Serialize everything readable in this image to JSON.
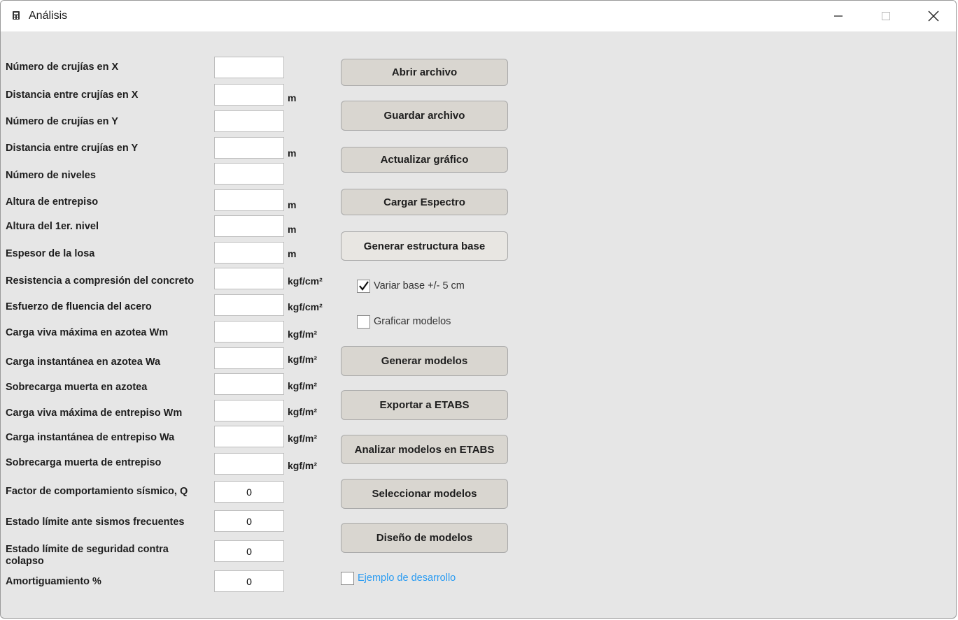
{
  "window": {
    "title": "Análisis",
    "app_icon": "calculator-icon",
    "controls": [
      "minimize-icon",
      "maximize-icon",
      "close-icon"
    ]
  },
  "form": {
    "fields": [
      {
        "label": "Número de crujías en X",
        "value": "",
        "unit": ""
      },
      {
        "label": "Distancia entre crujías en X",
        "value": "",
        "unit": "m"
      },
      {
        "label": "Número de crujías en Y",
        "value": "",
        "unit": ""
      },
      {
        "label": "Distancia entre crujías en Y",
        "value": "",
        "unit": "m"
      },
      {
        "label": "Número de niveles",
        "value": "",
        "unit": ""
      },
      {
        "label": "Altura de entrepiso",
        "value": "",
        "unit": "m"
      },
      {
        "label": "Altura del 1er. nivel",
        "value": "",
        "unit": "m"
      },
      {
        "label": "Espesor de la losa",
        "value": "",
        "unit": "m"
      },
      {
        "label": "Resistencia a compresión del concreto",
        "value": "",
        "unit": "kgf/cm²"
      },
      {
        "label": "Esfuerzo de fluencia del acero",
        "value": "",
        "unit": "kgf/cm²"
      },
      {
        "label": "Carga viva máxima en azotea Wm",
        "value": "",
        "unit": "kgf/m²"
      },
      {
        "label": "Carga instantánea en azotea Wa",
        "value": "",
        "unit": "kgf/m²"
      },
      {
        "label": "Sobrecarga muerta en azotea",
        "value": "",
        "unit": "kgf/m²"
      },
      {
        "label": "Carga viva máxima de entrepiso Wm",
        "value": "",
        "unit": "kgf/m²"
      },
      {
        "label": "Carga instantánea de entrepiso Wa",
        "value": "",
        "unit": "kgf/m²"
      },
      {
        "label": "Sobrecarga muerta de entrepiso",
        "value": "",
        "unit": "kgf/m²"
      },
      {
        "label": "Factor de comportamiento sísmico, Q",
        "value": "0",
        "unit": ""
      },
      {
        "label": "Estado límite ante sismos frecuentes",
        "value": "0",
        "unit": ""
      },
      {
        "label": "Estado límite de seguridad contra colapso",
        "value": "0",
        "unit": ""
      },
      {
        "label": "Amortiguamiento %",
        "value": "0",
        "unit": ""
      }
    ]
  },
  "actions": {
    "open_file": "Abrir archivo",
    "save_file": "Guardar archivo",
    "update_chart": "Actualizar gráfico",
    "load_spectrum": "Cargar Espectro",
    "generate_base": "Generar estructura base",
    "generate_models": "Generar modelos",
    "export_etabs": "Exportar a ETABS",
    "analyze_etabs": "Analizar modelos en ETABS",
    "select_models": "Seleccionar modelos",
    "design_models": "Diseño de modelos"
  },
  "options": {
    "vary_base": {
      "label": "Variar base +/- 5 cm",
      "checked": true
    },
    "plot_models": {
      "label": "Graficar modelos",
      "checked": false
    },
    "dev_example": {
      "label": "Ejemplo de desarrollo",
      "checked": false
    }
  },
  "colors": {
    "background": "#e6e6e6",
    "button": "#d9d6d0",
    "link": "#2b9cf2"
  }
}
